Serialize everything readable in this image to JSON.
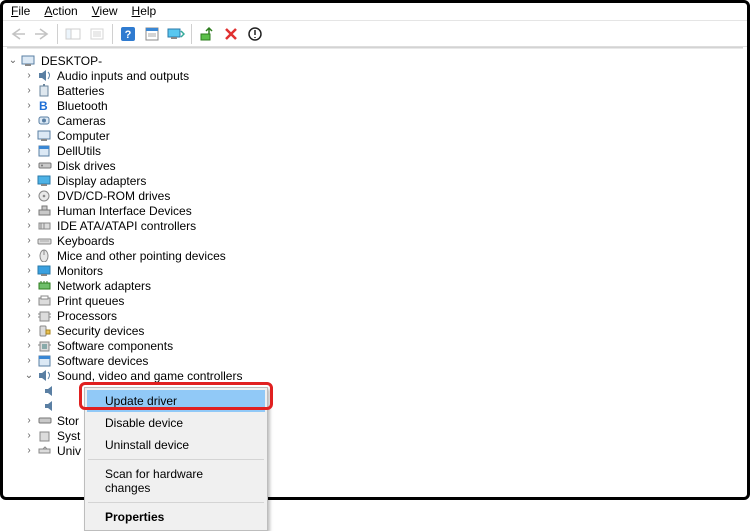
{
  "menu": {
    "file": "File",
    "action": "Action",
    "view": "View",
    "help": "Help"
  },
  "root": "DESKTOP-",
  "categories": [
    "Audio inputs and outputs",
    "Batteries",
    "Bluetooth",
    "Cameras",
    "Computer",
    "DellUtils",
    "Disk drives",
    "Display adapters",
    "DVD/CD-ROM drives",
    "Human Interface Devices",
    "IDE ATA/ATAPI controllers",
    "Keyboards",
    "Mice and other pointing devices",
    "Monitors",
    "Network adapters",
    "Print queues",
    "Processors",
    "Security devices",
    "Software components",
    "Software devices",
    "Sound, video and game controllers"
  ],
  "truncated": [
    "Stor",
    "Syst",
    "Univ"
  ],
  "context_menu": {
    "update": "Update driver",
    "disable": "Disable device",
    "uninstall": "Uninstall device",
    "scan": "Scan for hardware changes",
    "properties": "Properties"
  }
}
